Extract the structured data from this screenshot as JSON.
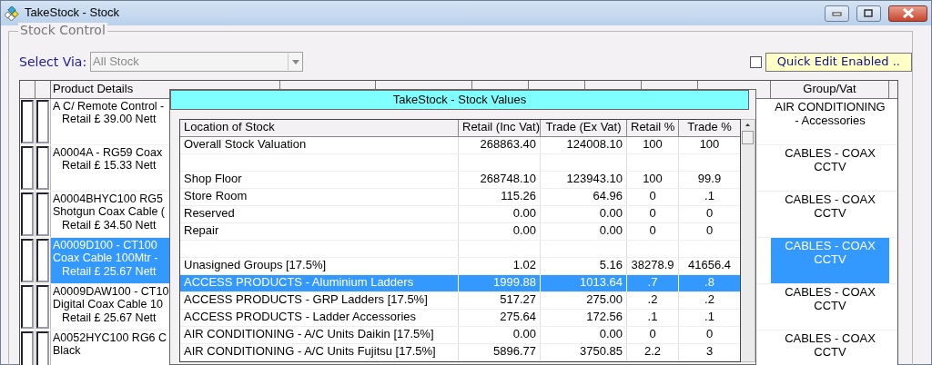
{
  "window": {
    "title": "TakeStock - Stock"
  },
  "stock_control": {
    "legend": "Stock Control",
    "select_label": "Select Via:",
    "select_value": "All Stock",
    "quick_edit_checked": false,
    "quick_edit_button": "Quick Edit Enabled .."
  },
  "main_grid": {
    "columns": [
      "Product Details",
      "Group/Vat"
    ],
    "rows": [
      {
        "product_lines": [
          "A C/ Remote Control -",
          "Retail £ 39.00   Nett"
        ],
        "group": "AIR CONDITIONING - Accessories",
        "selected": false
      },
      {
        "product_lines": [
          "A0004A - RG59 Coax",
          "Retail £ 15.33   Nett"
        ],
        "group": "CABLES - COAX CCTV",
        "selected": false
      },
      {
        "product_lines": [
          "A0004BHYC100  RG5",
          "Shotgun Coax Cable (",
          "Retail £ 34.50   Nett"
        ],
        "group": "CABLES - COAX CCTV",
        "selected": false
      },
      {
        "product_lines": [
          "A0009D100 - CT100",
          "Coax Cable 100Mtr -",
          "Retail £ 25.67   Nett"
        ],
        "group": "CABLES - COAX CCTV",
        "selected": true
      },
      {
        "product_lines": [
          "A0009DAW100 - CT10",
          "Digital Coax Cable 10",
          "Retail £ 25.67   Nett"
        ],
        "group": "CABLES - COAX CCTV",
        "selected": false
      },
      {
        "product_lines": [
          "A0052HYC100 RG6 C",
          "Black"
        ],
        "group": "CABLES - COAX CCTV",
        "selected": false
      }
    ]
  },
  "stock_values": {
    "title": "TakeStock - Stock Values",
    "columns": [
      "Location of Stock",
      "Retail (Inc Vat)",
      "Trade (Ex Vat)",
      "Retail %",
      "Trade %"
    ],
    "rows": [
      {
        "kind": "data",
        "cells": [
          "Overall Stock Valuation",
          "268863.40",
          "124008.10",
          "100",
          "100"
        ],
        "selected": false
      },
      {
        "kind": "spacer",
        "selected": false
      },
      {
        "kind": "data",
        "cells": [
          "Shop Floor",
          "268748.10",
          "123943.10",
          "100",
          "99.9"
        ],
        "selected": false
      },
      {
        "kind": "data",
        "cells": [
          "Store Room",
          "115.26",
          "64.96",
          "0",
          ".1"
        ],
        "selected": false
      },
      {
        "kind": "data",
        "cells": [
          "Reserved",
          "0.00",
          "0.00",
          "0",
          "0"
        ],
        "selected": false
      },
      {
        "kind": "data",
        "cells": [
          "Repair",
          "0.00",
          "0.00",
          "0",
          "0"
        ],
        "selected": false
      },
      {
        "kind": "spacer",
        "selected": false
      },
      {
        "kind": "data",
        "cells": [
          "Unasigned Groups [17.5%]",
          "1.02",
          "5.16",
          "38278.9",
          "41656.4"
        ],
        "selected": false
      },
      {
        "kind": "data",
        "cells": [
          "ACCESS PRODUCTS - Aluminium Ladders",
          "1999.88",
          "1013.64",
          ".7",
          ".8"
        ],
        "selected": true
      },
      {
        "kind": "data",
        "cells": [
          "ACCESS PRODUCTS - GRP Ladders [17.5%]",
          "517.27",
          "275.00",
          ".2",
          ".2"
        ],
        "selected": false
      },
      {
        "kind": "data",
        "cells": [
          "ACCESS PRODUCTS - Ladder Accessories",
          "275.64",
          "172.56",
          ".1",
          ".1"
        ],
        "selected": false
      },
      {
        "kind": "data",
        "cells": [
          "AIR CONDITIONING - A/C Units Daikin [17.5%]",
          "0.00",
          "0.00",
          "0",
          "0"
        ],
        "selected": false
      },
      {
        "kind": "data",
        "cells": [
          "AIR CONDITIONING - A/C Units Fujitsu [17.5%]",
          "5896.77",
          "3750.85",
          "2.2",
          "3"
        ],
        "selected": false
      }
    ]
  }
}
